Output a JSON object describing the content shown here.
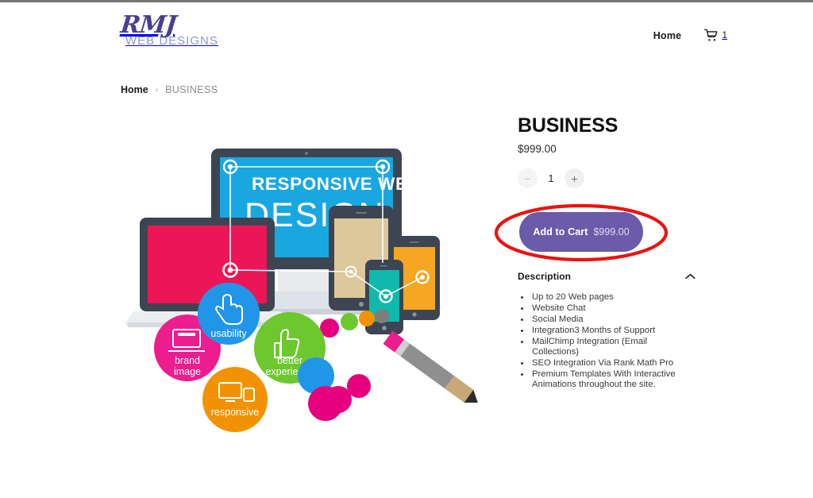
{
  "header": {
    "logo": {
      "mark": "RMJ",
      "subtitle": "WEB DESIGNS",
      "mark_color": "#4a3f8f",
      "subtitle_color": "#8b96d4"
    },
    "nav": {
      "home_label": "Home",
      "cart_icon": "shopping-cart-icon",
      "cart_count": "1"
    }
  },
  "breadcrumb": {
    "home_label": "Home",
    "separator": "›",
    "current_label": "BUSINESS"
  },
  "product_image": {
    "headline_top": "RESPONSIVE WEB",
    "headline_bottom": "DESIGN",
    "bubbles": [
      {
        "label": "usability",
        "color": "#2196e8",
        "icon": "cursor-hand-icon"
      },
      {
        "label": "brand image",
        "label_line1": "brand",
        "label_line2": "image",
        "color": "#ec1d8e",
        "icon": "laptop-icon"
      },
      {
        "label": "better experience",
        "label_line1": "better",
        "label_line2": "experience",
        "color": "#6dc72e",
        "icon": "thumbs-up-icon"
      },
      {
        "label": "responsive",
        "color": "#f39200",
        "icon": "devices-icon"
      }
    ],
    "device_colors": {
      "monitor_screen": "#19a7e0",
      "laptop_screen": "#ec1656",
      "tablet_screen": "#dcc89a",
      "phone_screen": "#0fb9ac",
      "tablet2_screen": "#f5a623",
      "bezel": "#3d4552"
    }
  },
  "product": {
    "title": "BUSINESS",
    "price": "$999.00",
    "quantity": {
      "decrease_label": "−",
      "value": "1",
      "increase_label": "+"
    },
    "add_to_cart": {
      "label": "Add to Cart",
      "price": "$999.00",
      "background_color": "#6b5bab"
    },
    "annotation": {
      "shape": "ellipse",
      "color": "#ee1111",
      "stroke_width": "4"
    }
  },
  "description": {
    "title": "Description",
    "expanded": true,
    "chevron_icon": "chevron-up-icon",
    "items": [
      "Up to 20 Web pages",
      "Website Chat",
      "Social Media",
      "Integration3 Months of Support",
      "MailChimp Integration (Email Collections)",
      "SEO Integration Via Rank Math Pro",
      "Premium Templates With Interactive Animations throughout the site."
    ]
  }
}
